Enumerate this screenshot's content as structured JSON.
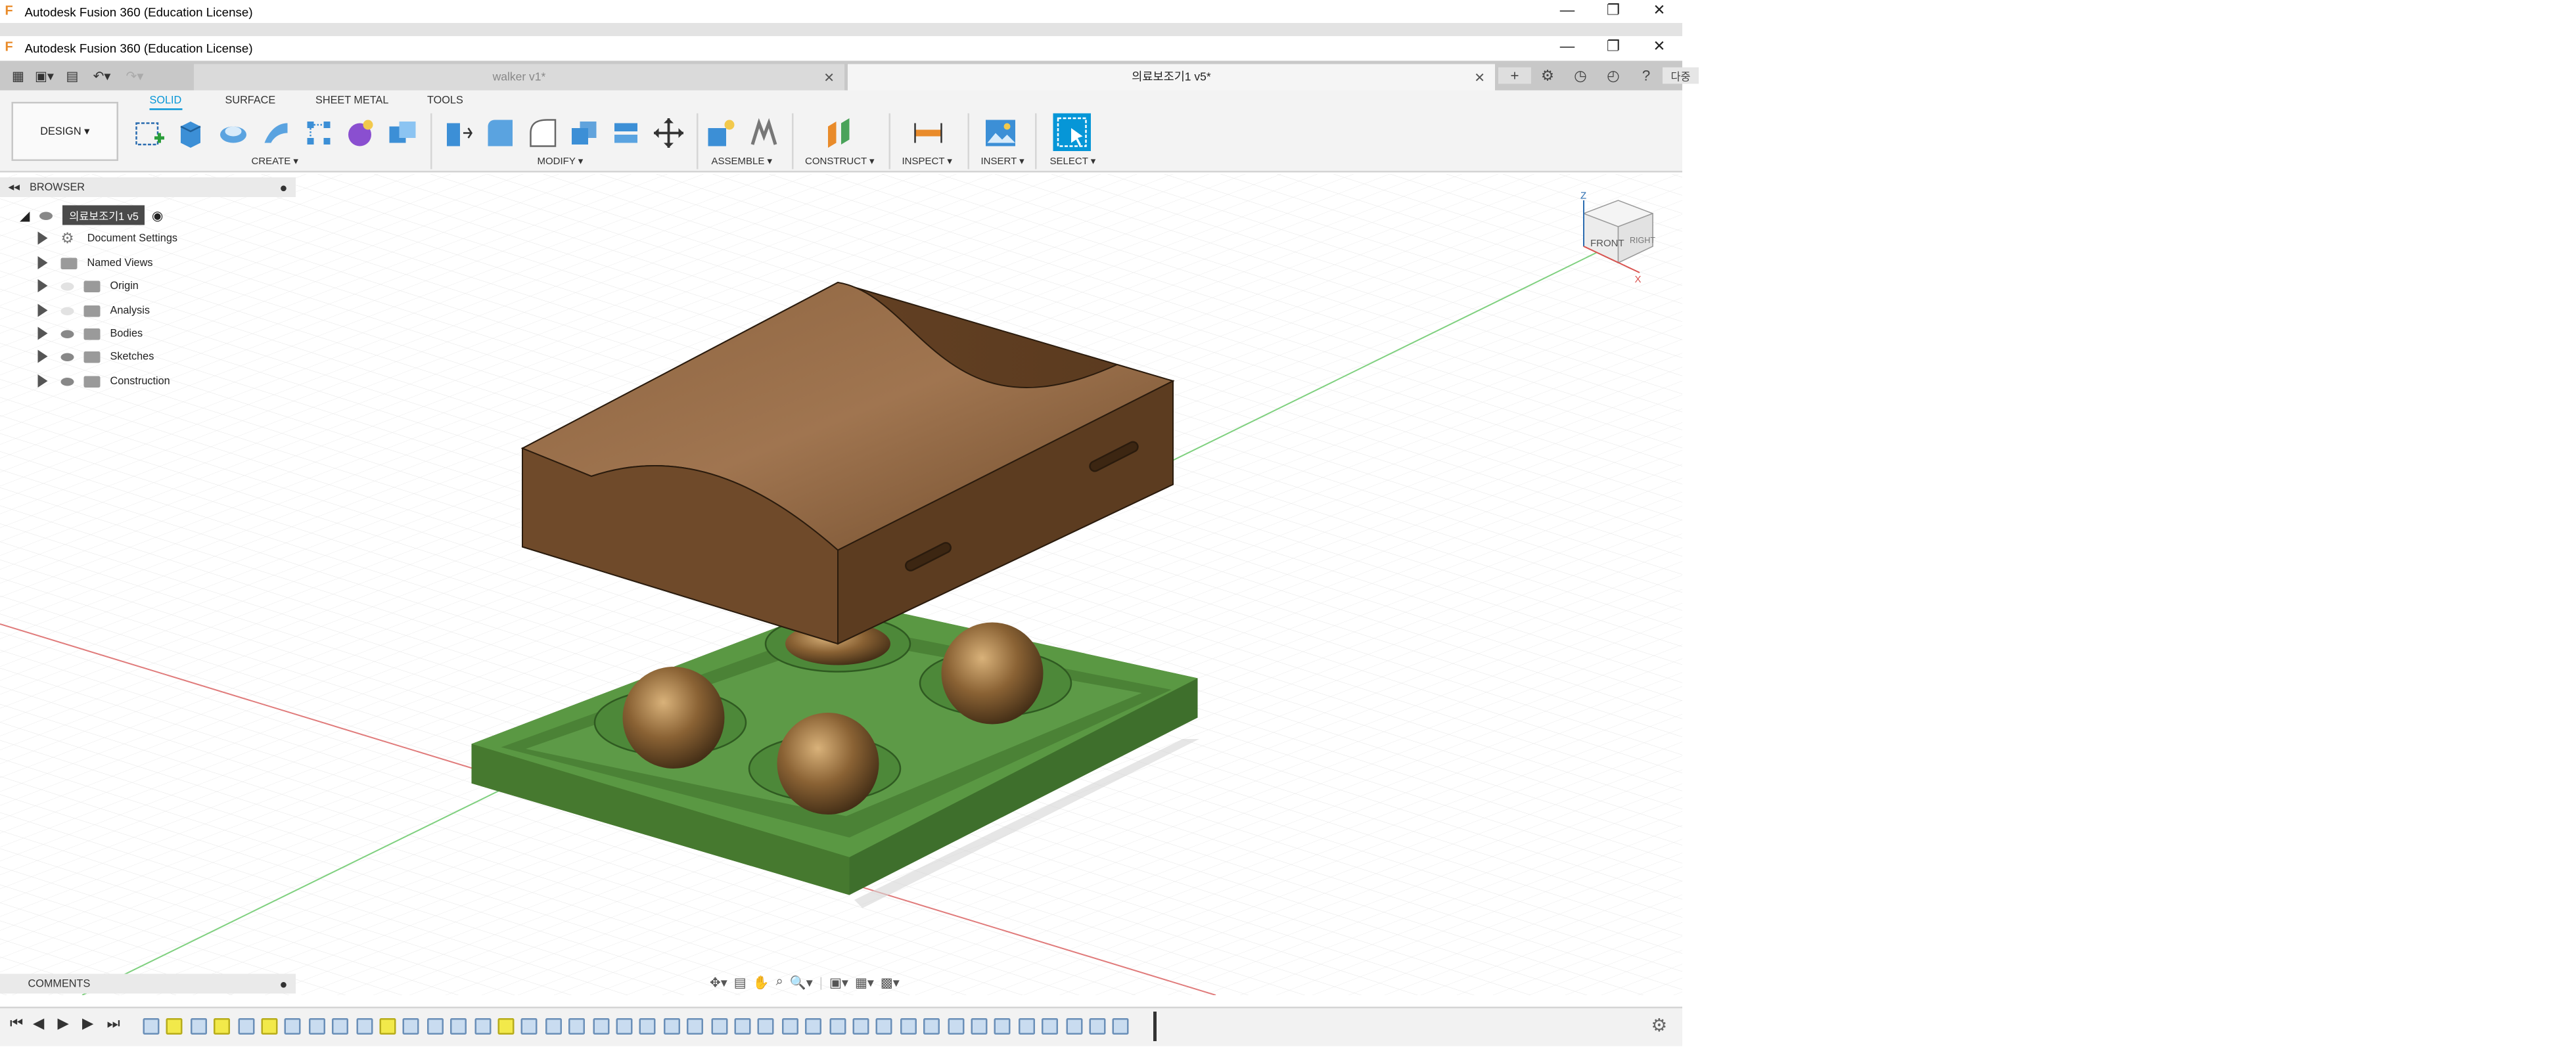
{
  "window": {
    "outer_title": "Autodesk Fusion 360 (Education License)",
    "inner_title": "Autodesk Fusion 360 (Education License)"
  },
  "tabs": [
    {
      "label": "walker v1*",
      "active": false
    },
    {
      "label": "의료보조기1 v5*",
      "active": true
    }
  ],
  "tabbar_right_label": "다중",
  "workspace": {
    "label": "DESIGN ▾"
  },
  "ribbon_tabs": [
    "SOLID",
    "SURFACE",
    "SHEET METAL",
    "TOOLS"
  ],
  "ribbon_groups": [
    "CREATE ▾",
    "MODIFY ▾",
    "ASSEMBLE ▾",
    "CONSTRUCT ▾",
    "INSPECT ▾",
    "INSERT ▾",
    "SELECT ▾"
  ],
  "browser": {
    "header": "BROWSER",
    "root": "의료보조기1 v5",
    "items": [
      "Document Settings",
      "Named Views",
      "Origin",
      "Analysis",
      "Bodies",
      "Sketches",
      "Construction"
    ]
  },
  "comments": {
    "label": "COMMENTS"
  },
  "viewcube": {
    "front": "FRONT",
    "right": "RIGHT",
    "axis_z": "Z",
    "axis_x": "X"
  },
  "colors": {
    "accent": "#0696d7",
    "model_brown": "#7a5230",
    "base_green": "#4f8a3a"
  }
}
